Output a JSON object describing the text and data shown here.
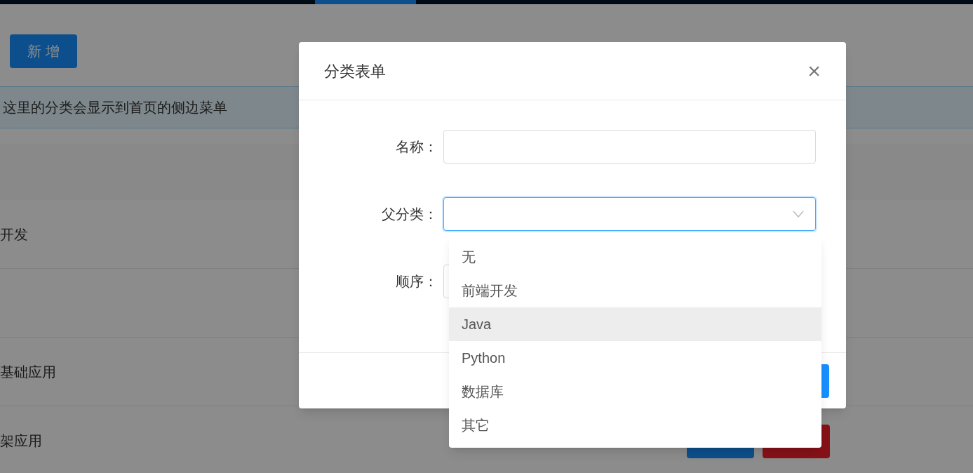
{
  "add_button": "新 增",
  "notice": "这里的分类会显示到首页的侧边菜单",
  "table": {
    "rows": [
      {
        "name": "开发"
      },
      {},
      {
        "name": "基础应用"
      },
      {
        "name": "架应用"
      }
    ],
    "action_buttons": [
      {
        "kind": "edit"
      },
      {
        "kind": "delete"
      }
    ]
  },
  "dialog": {
    "title": "分类表单",
    "close": "×",
    "fields": [
      {
        "kind": "input",
        "label": "名称：",
        "focused": false
      },
      {
        "kind": "select",
        "label": "父分类：",
        "focused": true
      },
      {
        "kind": "input",
        "label": "顺序：",
        "focused": false
      }
    ],
    "dropdown": [
      {
        "label": "无",
        "hovered": false
      },
      {
        "label": "前端开发",
        "hovered": false
      },
      {
        "label": "Java",
        "hovered": true
      },
      {
        "label": "Python",
        "hovered": false
      },
      {
        "label": "数据库",
        "hovered": false
      },
      {
        "label": "其它",
        "hovered": false
      }
    ]
  }
}
